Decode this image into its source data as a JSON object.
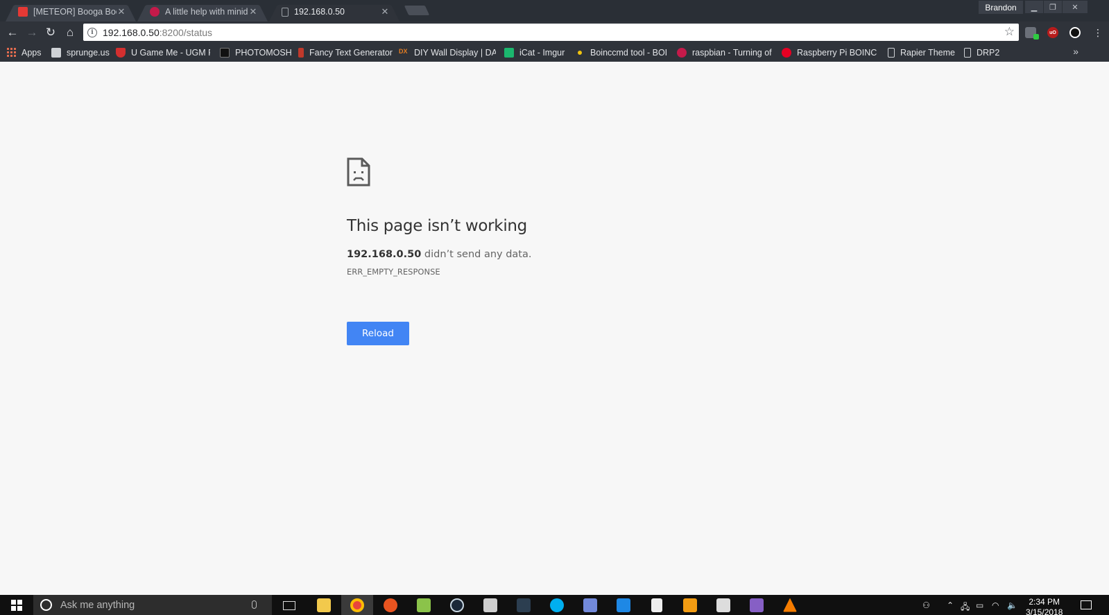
{
  "browser": {
    "tabs": [
      {
        "title": "[METEOR] Booga Booga",
        "favicon": "roblox-icon",
        "color": "#e53935",
        "active": false
      },
      {
        "title": "A little help with minidlna",
        "favicon": "raspberry-icon",
        "color": "#c51a4a",
        "active": false
      },
      {
        "title": "192.168.0.50",
        "favicon": "page-icon",
        "color": "#9aa0a6",
        "active": true
      }
    ],
    "profile_name": "Brandon",
    "url": {
      "host": "192.168.0.50",
      "rest": ":8200/status"
    },
    "bookmarks": [
      {
        "label": "Apps",
        "icon": "apps-grid-icon"
      },
      {
        "label": "sprunge.us",
        "icon": "page-icon",
        "color": "#cfd2d6"
      },
      {
        "label": "U Game Me - UGM Fr",
        "icon": "ugm-icon",
        "color": "#d32f2f"
      },
      {
        "label": "PHOTOMOSH",
        "icon": "photomosh-icon",
        "color": "#111111"
      },
      {
        "label": "Fancy Text Generator",
        "icon": "fancy-text-icon",
        "color": "#c0392b"
      },
      {
        "label": "DIY Wall Display | DA",
        "icon": "dx-icon",
        "color": "#e67e22"
      },
      {
        "label": "iCat - Imgur",
        "icon": "imgur-icon",
        "color": "#1bb76e"
      },
      {
        "label": "Boinccmd tool - BOIN",
        "icon": "dot-icon",
        "color": "#f1c40f"
      },
      {
        "label": "raspbian - Turning of",
        "icon": "raspberry-icon",
        "color": "#c51a4a"
      },
      {
        "label": "Raspberry Pi BOINC T",
        "icon": "pinterest-icon",
        "color": "#e60023"
      },
      {
        "label": "Rapier Theme",
        "icon": "page-icon",
        "color": "#cfd2d6"
      },
      {
        "label": "DRP2",
        "icon": "page-icon",
        "color": "#cfd2d6"
      }
    ],
    "more_label": "»"
  },
  "error_page": {
    "title": "This page isn’t working",
    "host": "192.168.0.50",
    "description": " didn’t send any data.",
    "code": "ERR_EMPTY_RESPONSE",
    "reload_label": "Reload"
  },
  "taskbar": {
    "search_placeholder": "Ask me anything",
    "time": "2:34 PM",
    "date": "3/15/2018",
    "apps": [
      {
        "name": "file-explorer-icon",
        "color": "#f2c94c",
        "active": false
      },
      {
        "name": "chrome-icon",
        "color": "#e8453c",
        "active": true
      },
      {
        "name": "ubuntu-icon",
        "color": "#e95420",
        "active": false
      },
      {
        "name": "notepad-plus-icon",
        "color": "#8bc34a",
        "active": false
      },
      {
        "name": "steam-icon",
        "color": "#1b2838",
        "active": false
      },
      {
        "name": "keepass-icon",
        "color": "#cfcfcf",
        "active": false
      },
      {
        "name": "screen-icon",
        "color": "#2c3e50",
        "active": false
      },
      {
        "name": "skype-icon",
        "color": "#00aff0",
        "active": false
      },
      {
        "name": "discord-icon",
        "color": "#7289da",
        "active": false
      },
      {
        "name": "remote-desktop-icon",
        "color": "#1e88e5",
        "active": false
      },
      {
        "name": "document-icon",
        "color": "#eeeeee",
        "active": false
      },
      {
        "name": "epic-icon",
        "color": "#f39c12",
        "active": false
      },
      {
        "name": "calculator-icon",
        "color": "#dddddd",
        "active": false
      },
      {
        "name": "visual-studio-icon",
        "color": "#865fc5",
        "active": false
      },
      {
        "name": "vlc-icon",
        "color": "#f57c00",
        "active": false
      }
    ]
  }
}
